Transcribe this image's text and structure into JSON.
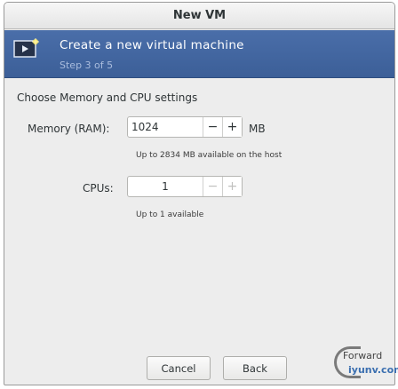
{
  "window": {
    "title": "New VM"
  },
  "header": {
    "title": "Create a new virtual machine",
    "step": "Step 3 of 5",
    "icon": "vm-monitor-icon"
  },
  "section": {
    "title": "Choose Memory and CPU settings"
  },
  "memory": {
    "label": "Memory (RAM):",
    "value": "1024",
    "unit": "MB",
    "hint": "Up to 2834 MB available on the host"
  },
  "cpus": {
    "label": "CPUs:",
    "value": "1",
    "hint": "Up to 1 available"
  },
  "buttons": {
    "minus": "−",
    "plus": "+",
    "cancel": "Cancel",
    "back": "Back",
    "forward": "Forward"
  },
  "watermark": {
    "top": "Forward",
    "bottom": "iyunv.com"
  }
}
